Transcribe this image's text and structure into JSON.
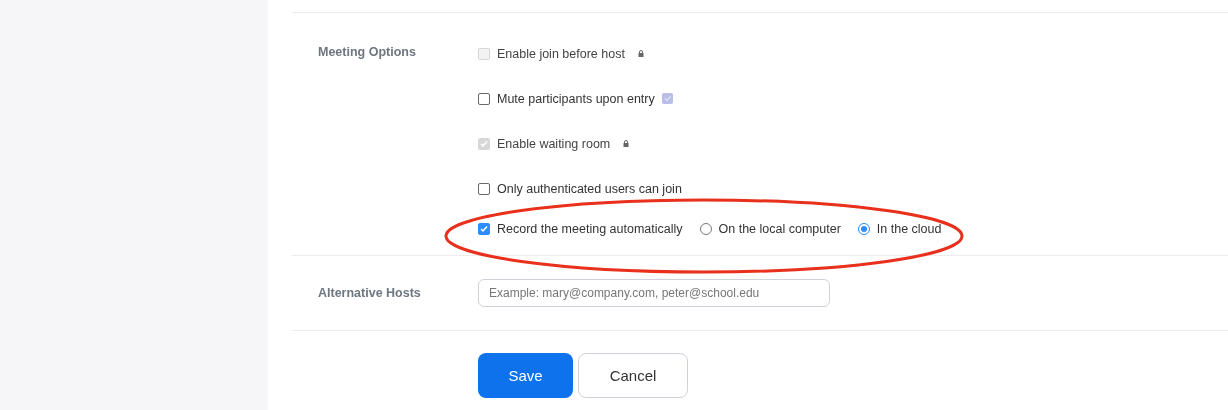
{
  "meeting_options": {
    "label": "Meeting Options",
    "options": [
      {
        "kind": "checkbox",
        "label": "Enable join before host",
        "checked": false,
        "disabled": true,
        "locked": true
      },
      {
        "kind": "checkbox",
        "label": "Mute participants upon entry",
        "checked": false,
        "disabled": false,
        "has_info": true
      },
      {
        "kind": "checkbox",
        "label": "Enable waiting room",
        "checked": true,
        "disabled": true,
        "locked": true
      },
      {
        "kind": "checkbox",
        "label": "Only authenticated users can join",
        "checked": false,
        "disabled": false
      },
      {
        "kind": "record",
        "label": "Record the meeting automatically",
        "checked": true,
        "disabled": false,
        "choices": [
          {
            "label": "On the local computer",
            "selected": false
          },
          {
            "label": "In the cloud",
            "selected": true
          }
        ]
      }
    ]
  },
  "alternative_hosts": {
    "label": "Alternative Hosts",
    "placeholder": "Example: mary@company.com, peter@school.edu"
  },
  "buttons": [
    {
      "kind": "primary",
      "label": "Save"
    },
    {
      "kind": "secondary",
      "label": "Cancel"
    }
  ]
}
